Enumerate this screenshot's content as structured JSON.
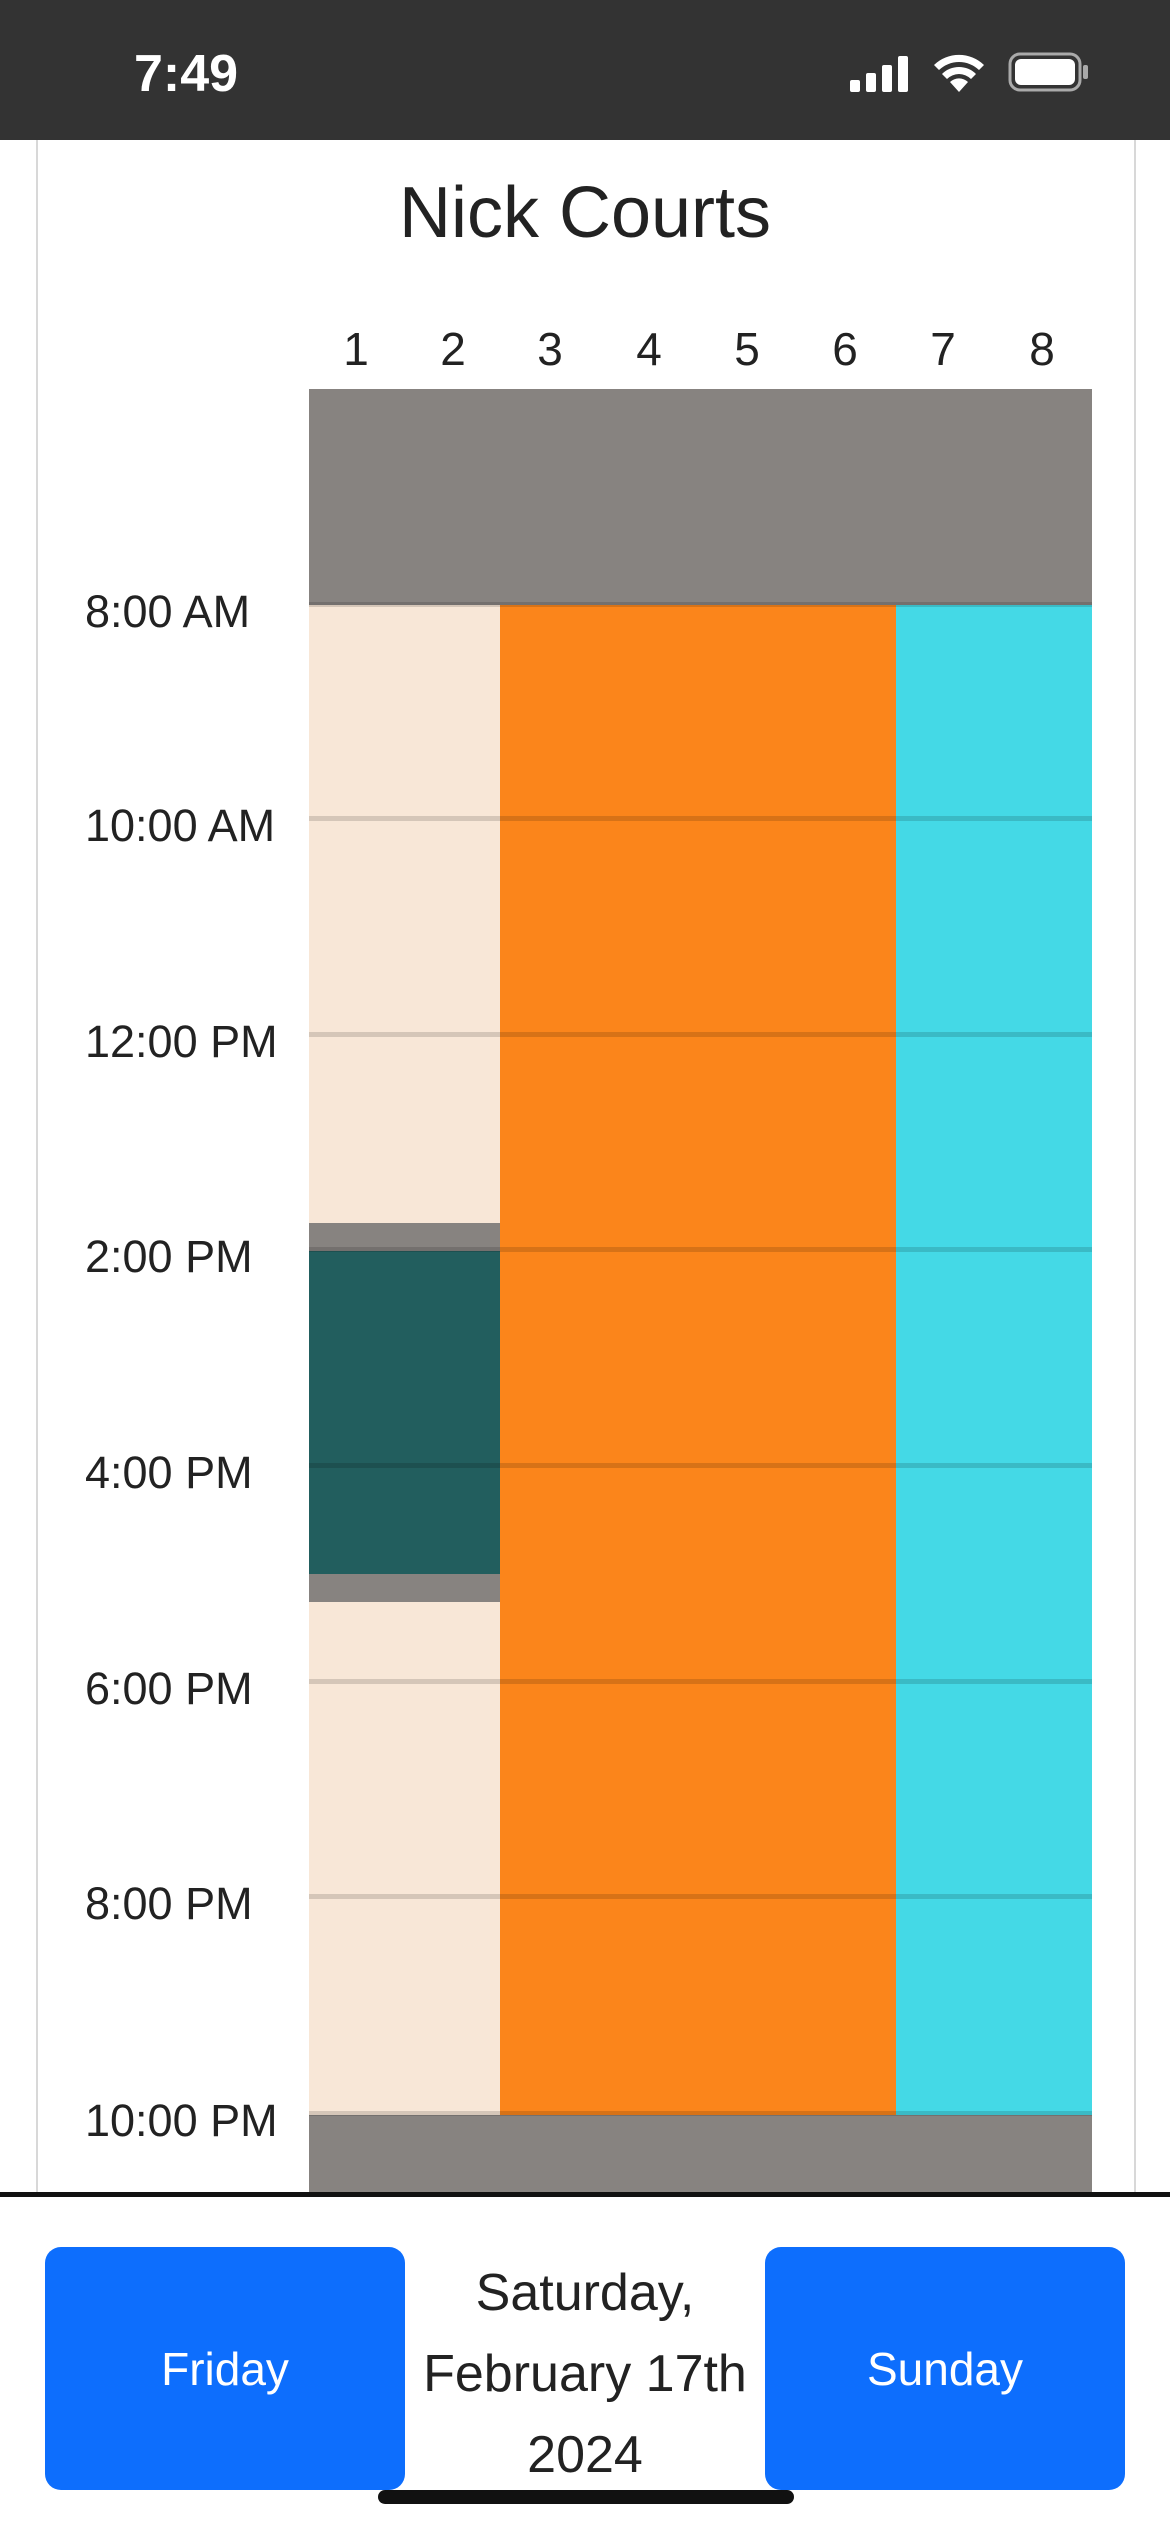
{
  "status_bar": {
    "time": "7:49",
    "icons": [
      "cellular-signal-icon",
      "wifi-icon",
      "battery-icon"
    ]
  },
  "page": {
    "title": "Nick Courts"
  },
  "schedule": {
    "courts": [
      "1",
      "2",
      "3",
      "4",
      "5",
      "6",
      "7",
      "8"
    ],
    "time_labels": [
      "8:00 AM",
      "10:00 AM",
      "12:00 PM",
      "2:00 PM",
      "4:00 PM",
      "6:00 PM",
      "8:00 PM",
      "10:00 PM"
    ],
    "reservations": [
      {
        "courts": "1-2",
        "start": "8:00 AM",
        "end": "1:45 PM",
        "color": "#f8e7d7"
      },
      {
        "courts": "1-2",
        "start": "2:00 PM",
        "end": "5:00 PM",
        "color": "#225e5e"
      },
      {
        "courts": "1-2",
        "start": "5:15 PM",
        "end": "10:00 PM",
        "color": "#f8e7d7"
      },
      {
        "courts": "3-6",
        "start": "8:00 AM",
        "end": "10:00 PM",
        "color": "#fb851b"
      },
      {
        "courts": "7-8",
        "start": "8:00 AM",
        "end": "10:00 PM",
        "color": "#44d9e6"
      }
    ],
    "closed_color": "#878380"
  },
  "navigation": {
    "prev_label": "Friday",
    "next_label": "Sunday",
    "date_line1": "Saturday,",
    "date_line2": "February 17th",
    "date_line3": "2024",
    "button_color": "#0d6efd"
  }
}
